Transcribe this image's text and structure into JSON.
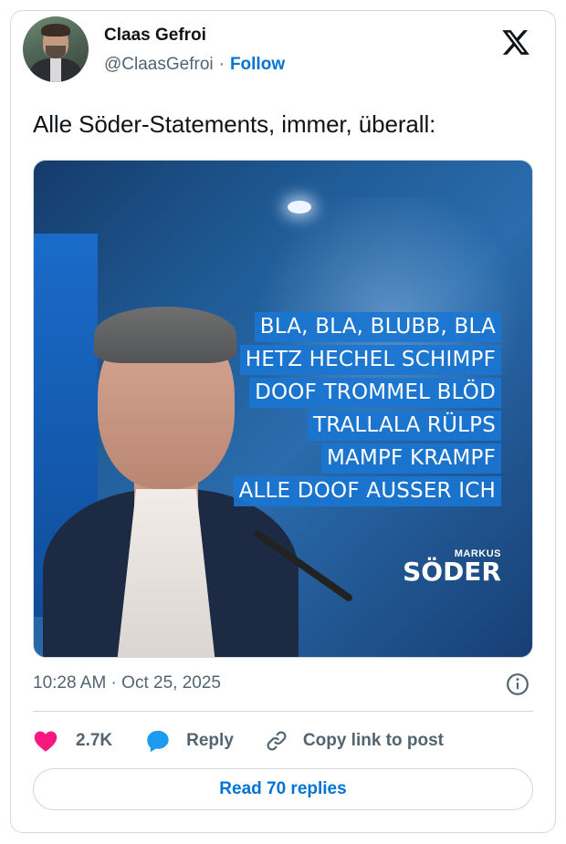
{
  "author": {
    "name": "Claas Gefroi",
    "handle": "@ClaasGefroi",
    "separator": "·",
    "follow_label": "Follow"
  },
  "tweet": {
    "text": "Alle Söder-Statements, immer, überall:",
    "timestamp": "10:28 AM · Oct 25, 2025"
  },
  "media": {
    "caption_lines": [
      "BLA, BLA, BLUBB, BLA",
      "HETZ HECHEL SCHIMPF",
      "DOOF TROMMEL BLÖD",
      "TRALLALA RÜLPS",
      "MAMPF KRAMPF",
      "ALLE DOOF AUSSER ICH"
    ],
    "brand_first": "MARKUS",
    "brand_last": "SÖDER"
  },
  "actions": {
    "like_count": "2.7K",
    "reply_label": "Reply",
    "copy_label": "Copy link to post"
  },
  "read_replies_label": "Read 70 replies",
  "icons": {
    "platform": "x-logo-icon",
    "like": "heart-icon",
    "reply": "speech-bubble-icon",
    "copy": "link-icon",
    "info": "info-icon"
  },
  "colors": {
    "accent": "#0074d4",
    "like": "#f91880",
    "reply": "#1d9bf0",
    "muted": "#536471",
    "caption_bg": "#1a75d2"
  }
}
